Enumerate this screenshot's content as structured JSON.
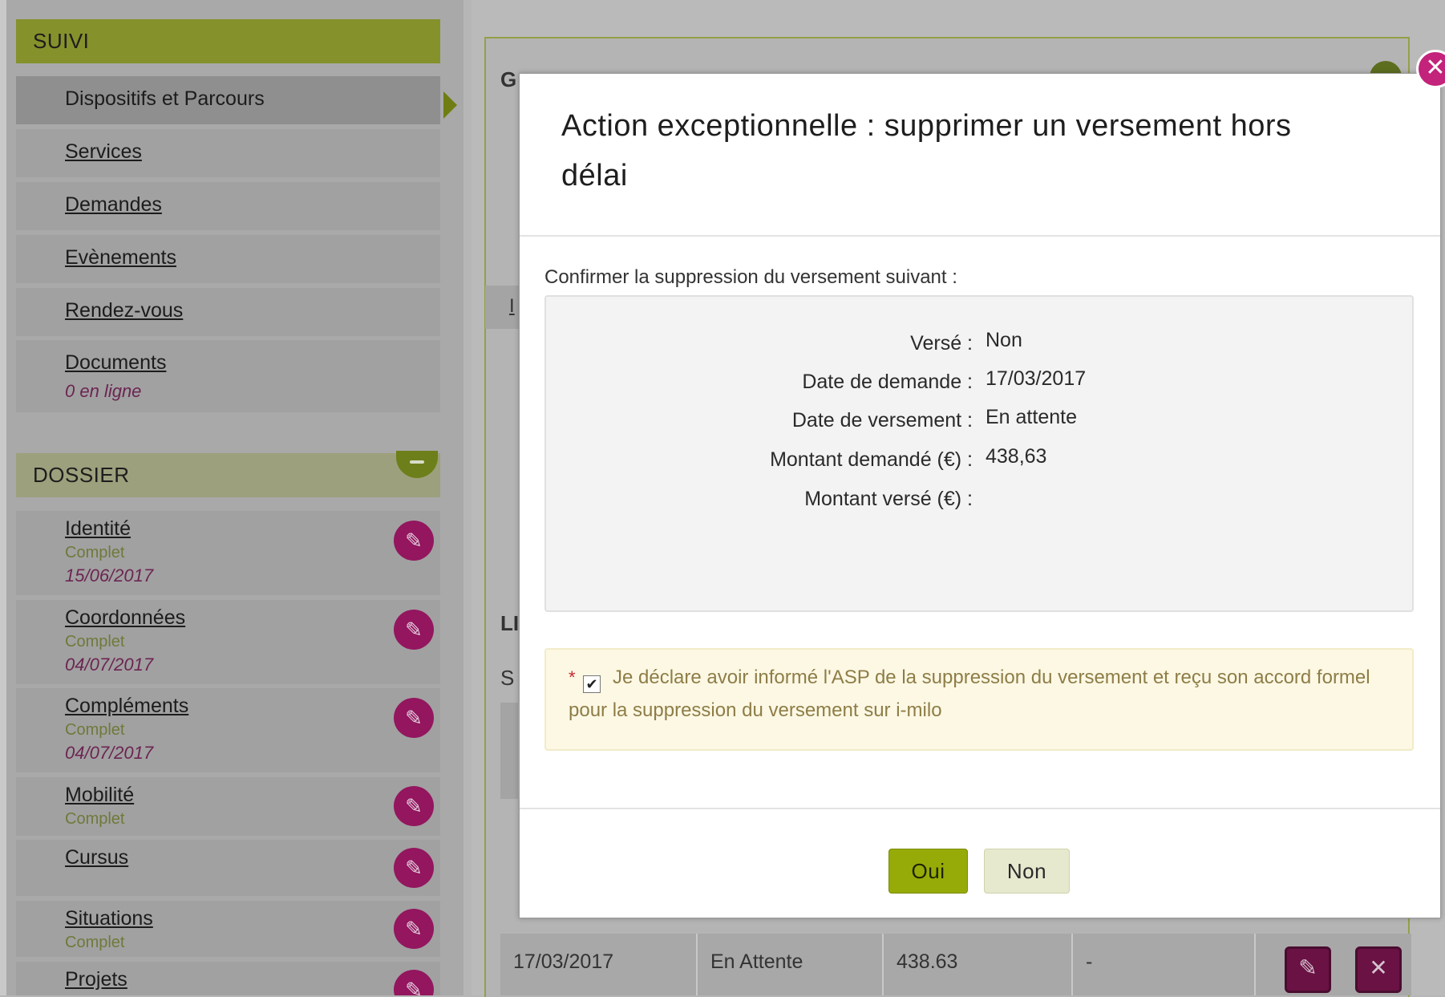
{
  "sidebar": {
    "suivi": {
      "title": "SUIVI",
      "items": [
        {
          "label": "Dispositifs et Parcours"
        },
        {
          "label": "Services"
        },
        {
          "label": "Demandes"
        },
        {
          "label": "Evènements"
        },
        {
          "label": "Rendez-vous"
        },
        {
          "label": "Documents",
          "sub": "0 en ligne"
        }
      ]
    },
    "dossier": {
      "title": "DOSSIER",
      "items": [
        {
          "label": "Identité",
          "status": "Complet",
          "date": "15/06/2017"
        },
        {
          "label": "Coordonnées",
          "status": "Complet",
          "date": "04/07/2017"
        },
        {
          "label": "Compléments",
          "status": "Complet",
          "date": "04/07/2017"
        },
        {
          "label": "Mobilité",
          "status": "Complet"
        },
        {
          "label": "Cursus"
        },
        {
          "label": "Situations",
          "status": "Complet"
        },
        {
          "label": "Projets"
        }
      ]
    }
  },
  "background": {
    "panel_title_fragment": "G",
    "section_fragment": "LI",
    "sub_fragment": "S",
    "tab_fragment": "I",
    "table_row": {
      "date": "17/03/2017",
      "status": "En Attente",
      "amount": "438.63",
      "paid": "-"
    }
  },
  "modal": {
    "title": "Action exceptionnelle : supprimer un versement hors délai",
    "confirm_text": "Confirmer la suppression du versement suivant :",
    "details": [
      {
        "key": "Versé :",
        "value": "Non"
      },
      {
        "key": "Date de demande :",
        "value": "17/03/2017"
      },
      {
        "key": "Date de versement :",
        "value": "En attente"
      },
      {
        "key": "Montant demandé (€) :",
        "value": "438,63"
      },
      {
        "key": "Montant versé (€) :",
        "value": ""
      }
    ],
    "required_marker": "*",
    "declaration": "Je déclare avoir informé l'ASP de la suppression du versement et reçu son accord formel pour la suppression du versement sur i-milo",
    "checkbox_checked": true,
    "buttons": {
      "yes": "Oui",
      "no": "Non"
    },
    "close_glyph": "✕"
  },
  "icons": {
    "edit": "pencil-icon",
    "close": "close-icon",
    "delete": "delete-icon",
    "check": "check-icon"
  },
  "colors": {
    "brand_green": "#97ab08",
    "brand_magenta": "#c3237a",
    "sidebar_head": "#85912b"
  }
}
